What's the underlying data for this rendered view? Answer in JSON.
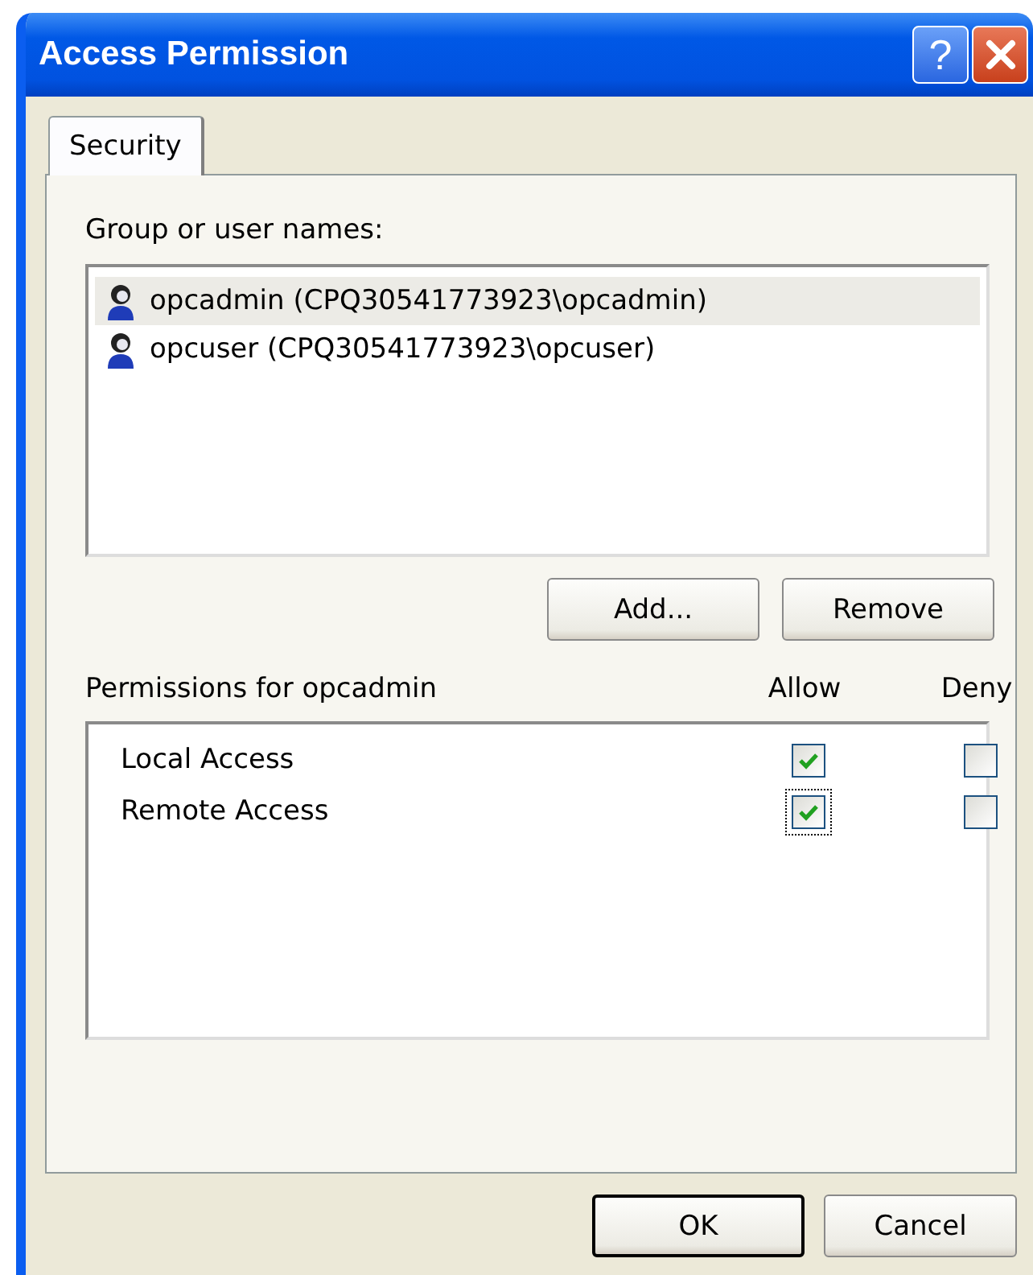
{
  "window": {
    "title": "Access Permission",
    "help_label": "?"
  },
  "tabs": [
    {
      "label": "Security",
      "selected": true
    }
  ],
  "users": {
    "label": "Group or user names:",
    "items": [
      {
        "name": "opcadmin (CPQ30541773923\\opcadmin)",
        "selected": true
      },
      {
        "name": "opcuser (CPQ30541773923\\opcuser)",
        "selected": false
      }
    ]
  },
  "user_buttons": [
    "Add...",
    "Remove"
  ],
  "permissions": {
    "label": "Permissions for opcadmin",
    "columns": [
      "Allow",
      "Deny"
    ],
    "rows": [
      {
        "name": "Local Access",
        "allow": true,
        "deny": false,
        "focused": false
      },
      {
        "name": "Remote Access",
        "allow": true,
        "deny": false,
        "focused": true
      }
    ]
  },
  "dialog_buttons": [
    {
      "label": "OK",
      "default": true
    },
    {
      "label": "Cancel",
      "default": false
    }
  ]
}
